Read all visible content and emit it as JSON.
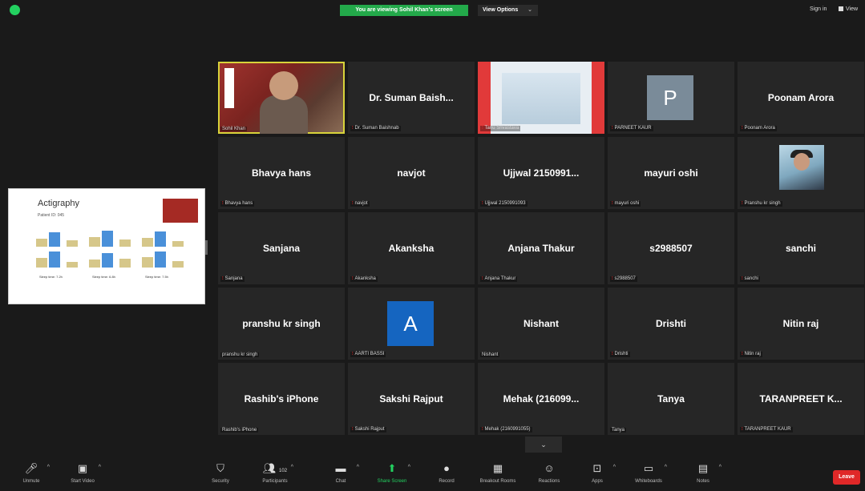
{
  "top": {
    "viewing_banner": "You are viewing Sohil Khan's screen",
    "view_options": "View Options",
    "view_options_chevron": "⌄",
    "sign_in": "Sign in",
    "view": "View"
  },
  "shared_screen": {
    "title": "Actigraphy",
    "subtitle": "Patient ID: 045",
    "stats": [
      "Sleep time: 7.2h",
      "Sleep time: 6.8h",
      "Sleep time: 7.5h"
    ]
  },
  "grid": {
    "tiles": [
      {
        "big": "",
        "name": "Sohil Khan",
        "mic": false
      },
      {
        "big": "Dr. Suman Baish...",
        "name": "Dr. Suman Baishnab",
        "mic": true
      },
      {
        "big": "",
        "name": "Tanu Srivastava",
        "mic": true
      },
      {
        "big": "",
        "name": "PARNEET KAUR",
        "mic": true,
        "avatar": "P"
      },
      {
        "big": "Poonam Arora",
        "name": "Poonam Arora",
        "mic": true
      },
      {
        "big": "Bhavya hans",
        "name": "Bhavya hans",
        "mic": true
      },
      {
        "big": "navjot",
        "name": "navjot",
        "mic": true
      },
      {
        "big": "Ujjwal 2150991...",
        "name": "Ujjwal 2150991093",
        "mic": true
      },
      {
        "big": "mayuri oshi",
        "name": "mayuri oshi",
        "mic": true
      },
      {
        "big": "",
        "name": "Pranshu kr singh",
        "mic": true
      },
      {
        "big": "Sanjana",
        "name": "Sanjana",
        "mic": true
      },
      {
        "big": "Akanksha",
        "name": "Akanksha",
        "mic": true
      },
      {
        "big": "Anjana Thakur",
        "name": "Anjana Thakur",
        "mic": true
      },
      {
        "big": "s2988507",
        "name": "s2988507",
        "mic": true
      },
      {
        "big": "sanchi",
        "name": "sanchi",
        "mic": true
      },
      {
        "big": "pranshu kr singh",
        "name": "pranshu kr singh",
        "mic": false
      },
      {
        "big": "",
        "name": "AARTI BASSI",
        "mic": true,
        "avatar": "A"
      },
      {
        "big": "Nishant",
        "name": "Nishant",
        "mic": false
      },
      {
        "big": "Drishti",
        "name": "Drishti",
        "mic": true
      },
      {
        "big": "Nitin raj",
        "name": "Nitin raj",
        "mic": true
      },
      {
        "big": "Rashib's iPhone",
        "name": "Rashib's iPhone",
        "mic": false
      },
      {
        "big": "Sakshi Rajput",
        "name": "Sakshi Rajput",
        "mic": true
      },
      {
        "big": "Mehak (216099...",
        "name": "Mehak (2160991055)",
        "mic": true
      },
      {
        "big": "Tanya",
        "name": "Tanya",
        "mic": false
      },
      {
        "big": "TARANPREET K...",
        "name": "TARANPREET KAUR",
        "mic": true
      }
    ]
  },
  "toolbar": {
    "unmute": "Unmute",
    "start_video": "Start Video",
    "security": "Security",
    "participants": "Participants",
    "participants_count": "102",
    "chat": "Chat",
    "share_screen": "Share Screen",
    "record": "Record",
    "breakout": "Breakout Rooms",
    "reactions": "Reactions",
    "apps": "Apps",
    "whiteboards": "Whiteboards",
    "notes": "Notes",
    "leave": "Leave"
  },
  "icons": {
    "mic_muted": "mic-muted-icon",
    "video_off": "video-off-icon",
    "security": "shield-icon",
    "participants": "people-icon"
  },
  "colors": {
    "accent_green": "#23d160",
    "leave_red": "#e02828",
    "active_speaker": "#d8d33a",
    "avatar_p": "#7a8b99",
    "avatar_a": "#1565c0"
  }
}
